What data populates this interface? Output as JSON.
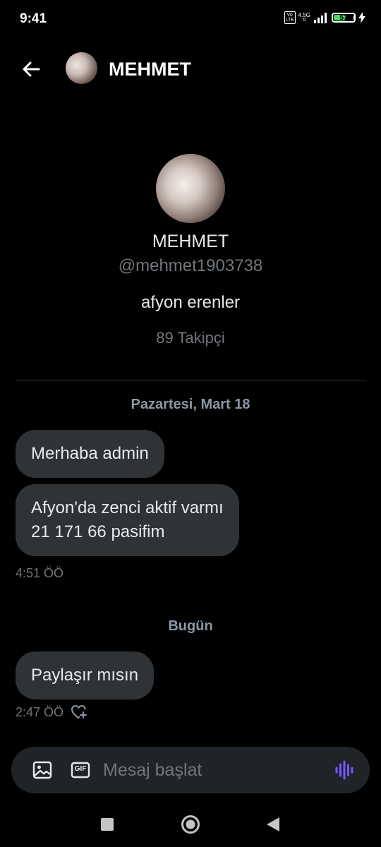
{
  "status_bar": {
    "time": "9:41",
    "volte": "Vo LTE",
    "network": "4.5G",
    "battery": "57"
  },
  "header": {
    "name": "MEHMET"
  },
  "profile": {
    "name": "MEHMET",
    "handle": "@mehmet1903738",
    "bio": "afyon erenler",
    "followers": "89 Takipçi"
  },
  "conversation": {
    "sections": [
      {
        "date": "Pazartesi, Mart 18",
        "messages": [
          {
            "lines": [
              "Merhaba admin"
            ]
          },
          {
            "lines": [
              "Afyon'da zenci aktif varmı",
              "21 171 66 pasifim"
            ]
          }
        ],
        "time": "4:51 ÖÖ"
      },
      {
        "date": "Bugün",
        "messages": [
          {
            "lines": [
              "Paylaşır mısın"
            ]
          }
        ],
        "time": "2:47 ÖÖ"
      }
    ]
  },
  "composer": {
    "placeholder": "Mesaj başlat",
    "gif_label": "GIF"
  },
  "colors": {
    "accent": "#7856ff",
    "background": "#000000",
    "bubble": "#2f3336",
    "muted": "#71767b"
  },
  "icons": [
    "back-arrow-icon",
    "image-icon",
    "gif-icon",
    "voice-icon",
    "heart-plus-icon",
    "recents-icon",
    "home-icon",
    "back-icon"
  ]
}
